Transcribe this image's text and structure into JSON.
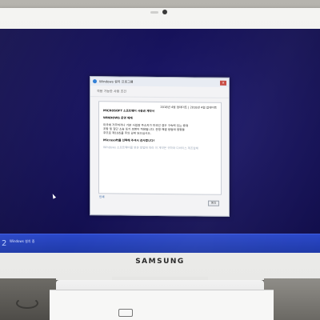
{
  "dialog": {
    "title": "Windows 설치 프로그램",
    "close_label": "✕",
    "heading": "적용 가능한 사용 조건",
    "terms_lines": [
      {
        "text": "2018년 4월 업데이트 | 2018년 4월 업데이트",
        "style": "right"
      },
      {
        "text": "MICROSOFT 소프트웨어 사용권 계약서",
        "style": "heading"
      },
      {
        "text": "",
        "style": "gap"
      },
      {
        "text": "WINDOWS 운영 체제",
        "style": "heading"
      },
      {
        "text": "",
        "style": "gap"
      },
      {
        "text": "미국에 거주하거나 기본 사업장 주소지가 미국인 경우 구속력 있는 중재",
        "style": "normal"
      },
      {
        "text": "조항 및 집단 소송 포기 조항이 적용됩니다. 분쟁 해결 방법에 영향을",
        "style": "normal"
      },
      {
        "text": "주므로 제10조를 주의 깊게 읽으십시오.",
        "style": "normal"
      },
      {
        "text": "",
        "style": "gap"
      },
      {
        "text": "Microsoft를 선택해 주셔서 감사합니다!",
        "style": "heading"
      },
      {
        "text": "",
        "style": "gap"
      },
      {
        "text": "Windows 소프트웨어를 얻은 방법에 따라 이 계약은 귀하와 디바이스 제조업체",
        "style": "faded"
      }
    ],
    "print_link": "인쇄",
    "accept_button": "동의"
  },
  "taskbar": {
    "mark": "2",
    "text": "Windows 설치 중"
  },
  "monitor": {
    "brand": "SAMSUNG"
  }
}
